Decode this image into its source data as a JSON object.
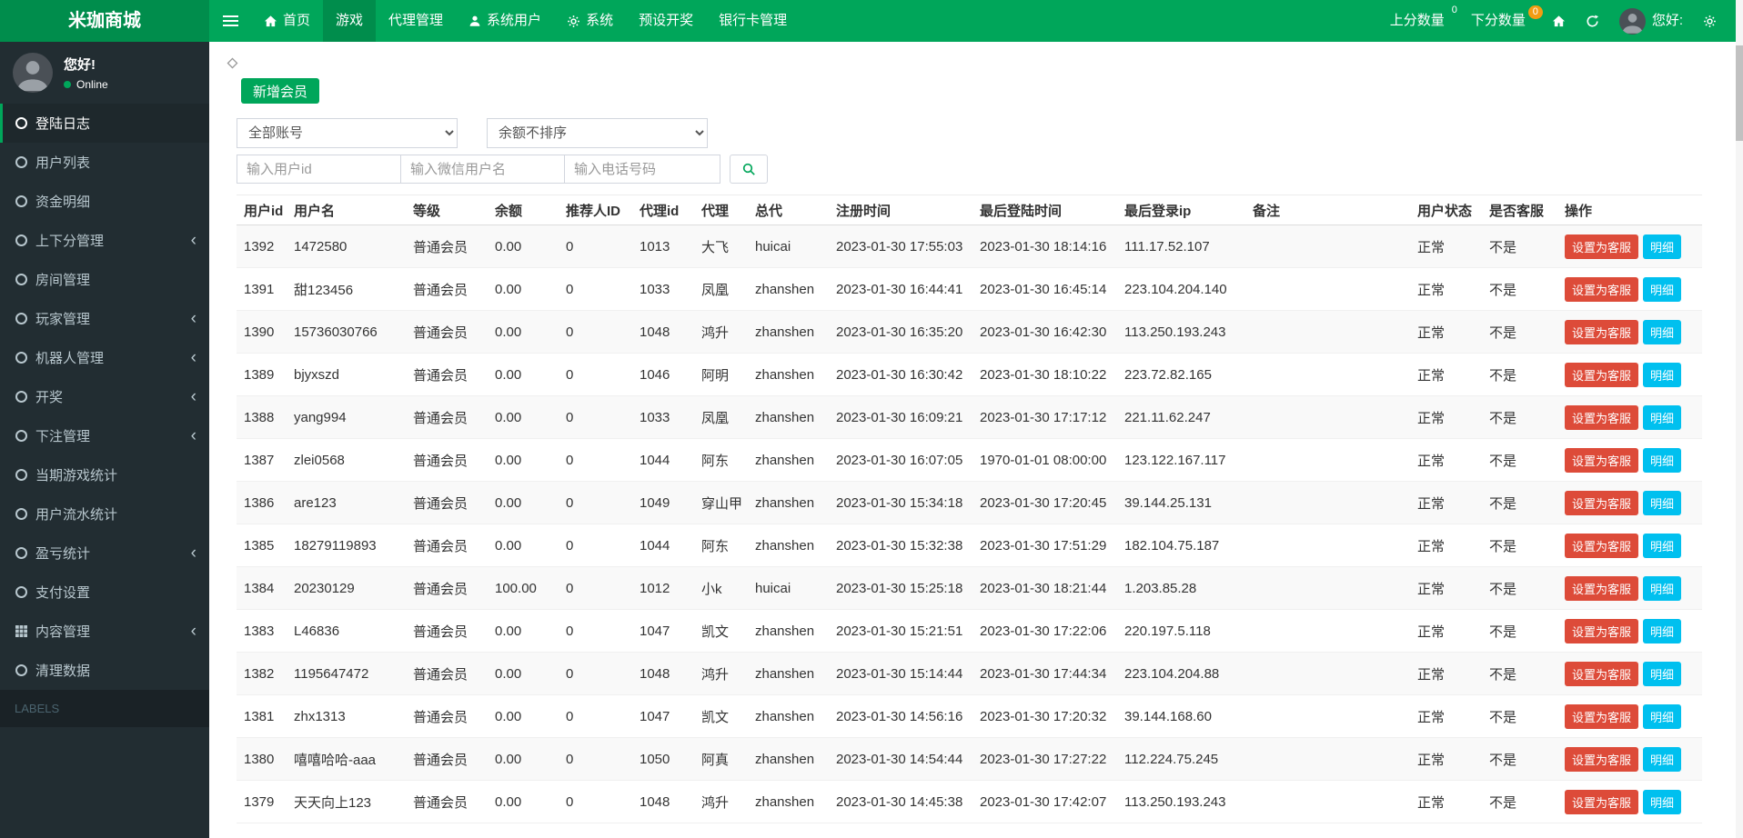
{
  "colors": {
    "primary_green": "#00a65a",
    "dark_green": "#008d4c",
    "sidebar_bg": "#222d32",
    "danger_red": "#dd4b39",
    "info_blue": "#00c0ef",
    "badge_orange": "#f39c12"
  },
  "navbar": {
    "logo": "米珈商城",
    "items": [
      {
        "name": "home",
        "label": "首页",
        "icon": "home-icon",
        "active": false
      },
      {
        "name": "games",
        "label": "游戏",
        "icon": "",
        "active": true
      },
      {
        "name": "agent-management",
        "label": "代理管理",
        "icon": "",
        "active": false
      },
      {
        "name": "system-users",
        "label": "系统用户",
        "icon": "user-icon",
        "active": false
      },
      {
        "name": "system",
        "label": "系统",
        "icon": "gear-icon",
        "active": false
      },
      {
        "name": "preset-lottery",
        "label": "预设开奖",
        "icon": "",
        "active": false
      },
      {
        "name": "bank-card-management",
        "label": "银行卡管理",
        "icon": "",
        "active": false
      }
    ],
    "up_score": {
      "label": "上分数量",
      "badge": "0"
    },
    "down_score": {
      "label": "下分数量",
      "badge": "0"
    },
    "greeting": "您好:"
  },
  "sidebar": {
    "greeting": "您好!",
    "status": "Online",
    "items": [
      {
        "name": "login-log",
        "label": "登陆日志",
        "icon": "circle-icon",
        "active": true,
        "expandable": false
      },
      {
        "name": "user-list",
        "label": "用户列表",
        "icon": "circle-icon",
        "active": false,
        "expandable": false
      },
      {
        "name": "fund-details",
        "label": "资金明细",
        "icon": "circle-icon",
        "active": false,
        "expandable": false
      },
      {
        "name": "score-management",
        "label": "上下分管理",
        "icon": "circle-icon",
        "active": false,
        "expandable": true
      },
      {
        "name": "room-management",
        "label": "房间管理",
        "icon": "circle-icon",
        "active": false,
        "expandable": false
      },
      {
        "name": "player-management",
        "label": "玩家管理",
        "icon": "circle-icon",
        "active": false,
        "expandable": true
      },
      {
        "name": "robot-management",
        "label": "机器人管理",
        "icon": "circle-icon",
        "active": false,
        "expandable": true
      },
      {
        "name": "lottery",
        "label": "开奖",
        "icon": "circle-icon",
        "active": false,
        "expandable": true
      },
      {
        "name": "bet-management",
        "label": "下注管理",
        "icon": "circle-icon",
        "active": false,
        "expandable": true
      },
      {
        "name": "current-game-stats",
        "label": "当期游戏统计",
        "icon": "circle-icon",
        "active": false,
        "expandable": false
      },
      {
        "name": "user-flow-stats",
        "label": "用户流水统计",
        "icon": "circle-icon",
        "active": false,
        "expandable": false
      },
      {
        "name": "profit-loss-stats",
        "label": "盈亏统计",
        "icon": "circle-icon",
        "active": false,
        "expandable": true
      },
      {
        "name": "payment-settings",
        "label": "支付设置",
        "icon": "circle-icon",
        "active": false,
        "expandable": false
      },
      {
        "name": "content-management",
        "label": "内容管理",
        "icon": "grid-icon",
        "active": false,
        "expandable": true
      },
      {
        "name": "clean-data",
        "label": "清理数据",
        "icon": "circle-icon",
        "active": false,
        "expandable": false
      }
    ],
    "section_label": "LABELS"
  },
  "toolbar": {
    "add_member": "新增会员",
    "account_filter": "全部账号",
    "balance_sort": "余额不排序",
    "user_id_placeholder": "输入用户id",
    "wechat_placeholder": "输入微信用户名",
    "phone_placeholder": "输入电话号码"
  },
  "table": {
    "headers": [
      "用户id",
      "用户名",
      "等级",
      "余额",
      "推荐人ID",
      "代理id",
      "代理",
      "总代",
      "注册时间",
      "最后登陆时间",
      "最后登录ip",
      "备注",
      "用户状态",
      "是否客服",
      "操作"
    ],
    "set_cs_label": "设置为客服",
    "detail_label": "明细",
    "rows": [
      {
        "user_id": "1392",
        "username": "1472580",
        "level": "普通会员",
        "balance": "0.00",
        "referrer_id": "0",
        "agent_id": "1013",
        "agent": "大飞",
        "general_agent": "huicai",
        "reg_time": "2023-01-30 17:55:03",
        "last_login": "2023-01-30 18:14:16",
        "last_ip": "111.17.52.107",
        "remark": "",
        "status": "正常",
        "is_cs": "不是"
      },
      {
        "user_id": "1391",
        "username": "甜123456",
        "level": "普通会员",
        "balance": "0.00",
        "referrer_id": "0",
        "agent_id": "1033",
        "agent": "凤凰",
        "general_agent": "zhanshen",
        "reg_time": "2023-01-30 16:44:41",
        "last_login": "2023-01-30 16:45:14",
        "last_ip": "223.104.204.140",
        "remark": "",
        "status": "正常",
        "is_cs": "不是"
      },
      {
        "user_id": "1390",
        "username": "15736030766",
        "level": "普通会员",
        "balance": "0.00",
        "referrer_id": "0",
        "agent_id": "1048",
        "agent": "鸿升",
        "general_agent": "zhanshen",
        "reg_time": "2023-01-30 16:35:20",
        "last_login": "2023-01-30 16:42:30",
        "last_ip": "113.250.193.243",
        "remark": "",
        "status": "正常",
        "is_cs": "不是"
      },
      {
        "user_id": "1389",
        "username": "bjyxszd",
        "level": "普通会员",
        "balance": "0.00",
        "referrer_id": "0",
        "agent_id": "1046",
        "agent": "阿明",
        "general_agent": "zhanshen",
        "reg_time": "2023-01-30 16:30:42",
        "last_login": "2023-01-30 18:10:22",
        "last_ip": "223.72.82.165",
        "remark": "",
        "status": "正常",
        "is_cs": "不是"
      },
      {
        "user_id": "1388",
        "username": "yang994",
        "level": "普通会员",
        "balance": "0.00",
        "referrer_id": "0",
        "agent_id": "1033",
        "agent": "凤凰",
        "general_agent": "zhanshen",
        "reg_time": "2023-01-30 16:09:21",
        "last_login": "2023-01-30 17:17:12",
        "last_ip": "221.11.62.247",
        "remark": "",
        "status": "正常",
        "is_cs": "不是"
      },
      {
        "user_id": "1387",
        "username": "zlei0568",
        "level": "普通会员",
        "balance": "0.00",
        "referrer_id": "0",
        "agent_id": "1044",
        "agent": "阿东",
        "general_agent": "zhanshen",
        "reg_time": "2023-01-30 16:07:05",
        "last_login": "1970-01-01 08:00:00",
        "last_ip": "123.122.167.117",
        "remark": "",
        "status": "正常",
        "is_cs": "不是"
      },
      {
        "user_id": "1386",
        "username": "are123",
        "level": "普通会员",
        "balance": "0.00",
        "referrer_id": "0",
        "agent_id": "1049",
        "agent": "穿山甲",
        "general_agent": "zhanshen",
        "reg_time": "2023-01-30 15:34:18",
        "last_login": "2023-01-30 17:20:45",
        "last_ip": "39.144.25.131",
        "remark": "",
        "status": "正常",
        "is_cs": "不是"
      },
      {
        "user_id": "1385",
        "username": "18279119893",
        "level": "普通会员",
        "balance": "0.00",
        "referrer_id": "0",
        "agent_id": "1044",
        "agent": "阿东",
        "general_agent": "zhanshen",
        "reg_time": "2023-01-30 15:32:38",
        "last_login": "2023-01-30 17:51:29",
        "last_ip": "182.104.75.187",
        "remark": "",
        "status": "正常",
        "is_cs": "不是"
      },
      {
        "user_id": "1384",
        "username": "20230129",
        "level": "普通会员",
        "balance": "100.00",
        "referrer_id": "0",
        "agent_id": "1012",
        "agent": "小k",
        "general_agent": "huicai",
        "reg_time": "2023-01-30 15:25:18",
        "last_login": "2023-01-30 18:21:44",
        "last_ip": "1.203.85.28",
        "remark": "",
        "status": "正常",
        "is_cs": "不是"
      },
      {
        "user_id": "1383",
        "username": "L46836",
        "level": "普通会员",
        "balance": "0.00",
        "referrer_id": "0",
        "agent_id": "1047",
        "agent": "凯文",
        "general_agent": "zhanshen",
        "reg_time": "2023-01-30 15:21:51",
        "last_login": "2023-01-30 17:22:06",
        "last_ip": "220.197.5.118",
        "remark": "",
        "status": "正常",
        "is_cs": "不是"
      },
      {
        "user_id": "1382",
        "username": "1195647472",
        "level": "普通会员",
        "balance": "0.00",
        "referrer_id": "0",
        "agent_id": "1048",
        "agent": "鸿升",
        "general_agent": "zhanshen",
        "reg_time": "2023-01-30 15:14:44",
        "last_login": "2023-01-30 17:44:34",
        "last_ip": "223.104.204.88",
        "remark": "",
        "status": "正常",
        "is_cs": "不是"
      },
      {
        "user_id": "1381",
        "username": "zhx1313",
        "level": "普通会员",
        "balance": "0.00",
        "referrer_id": "0",
        "agent_id": "1047",
        "agent": "凯文",
        "general_agent": "zhanshen",
        "reg_time": "2023-01-30 14:56:16",
        "last_login": "2023-01-30 17:20:32",
        "last_ip": "39.144.168.60",
        "remark": "",
        "status": "正常",
        "is_cs": "不是"
      },
      {
        "user_id": "1380",
        "username": "嘻嘻哈哈-aaa",
        "level": "普通会员",
        "balance": "0.00",
        "referrer_id": "0",
        "agent_id": "1050",
        "agent": "阿真",
        "general_agent": "zhanshen",
        "reg_time": "2023-01-30 14:54:44",
        "last_login": "2023-01-30 17:27:22",
        "last_ip": "112.224.75.245",
        "remark": "",
        "status": "正常",
        "is_cs": "不是"
      },
      {
        "user_id": "1379",
        "username": "天天向上123",
        "level": "普通会员",
        "balance": "0.00",
        "referrer_id": "0",
        "agent_id": "1048",
        "agent": "鸿升",
        "general_agent": "zhanshen",
        "reg_time": "2023-01-30 14:45:38",
        "last_login": "2023-01-30 17:42:07",
        "last_ip": "113.250.193.243",
        "remark": "",
        "status": "正常",
        "is_cs": "不是"
      }
    ]
  }
}
